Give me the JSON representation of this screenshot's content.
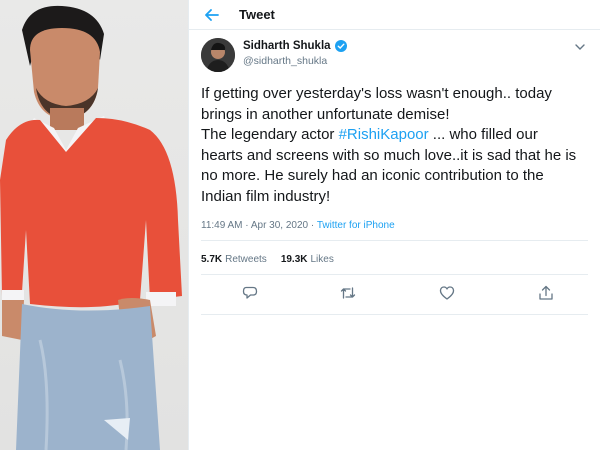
{
  "header": {
    "title": "Tweet"
  },
  "tweet": {
    "display_name": "Sidharth Shukla",
    "handle": "@sidharth_shukla",
    "text_lines": [
      "If getting over yesterday's loss wasn't enough.. today",
      "brings in another unfortunate demise!",
      "The legendary actor ",
      " ... who filled our",
      "hearts and screens with so much love..it is sad that he is",
      "no more. He surely had an iconic contribution to the",
      "Indian film industry!"
    ],
    "hashtag": "#RishiKapoor",
    "timestamp": "11:49 AM · Apr 30, 2020 · ",
    "source": "Twitter for iPhone",
    "retweets_count": "5.7K",
    "retweets_label": "Retweets",
    "likes_count": "19.3K",
    "likes_label": "Likes"
  },
  "colors": {
    "accent": "#1da1f2",
    "text": "#14171a",
    "muted": "#657786",
    "sweater": "#e8503a"
  },
  "icons": [
    "back-arrow-icon",
    "verified-icon",
    "chevron-down-icon",
    "reply-icon",
    "retweet-icon",
    "like-icon",
    "share-icon"
  ]
}
